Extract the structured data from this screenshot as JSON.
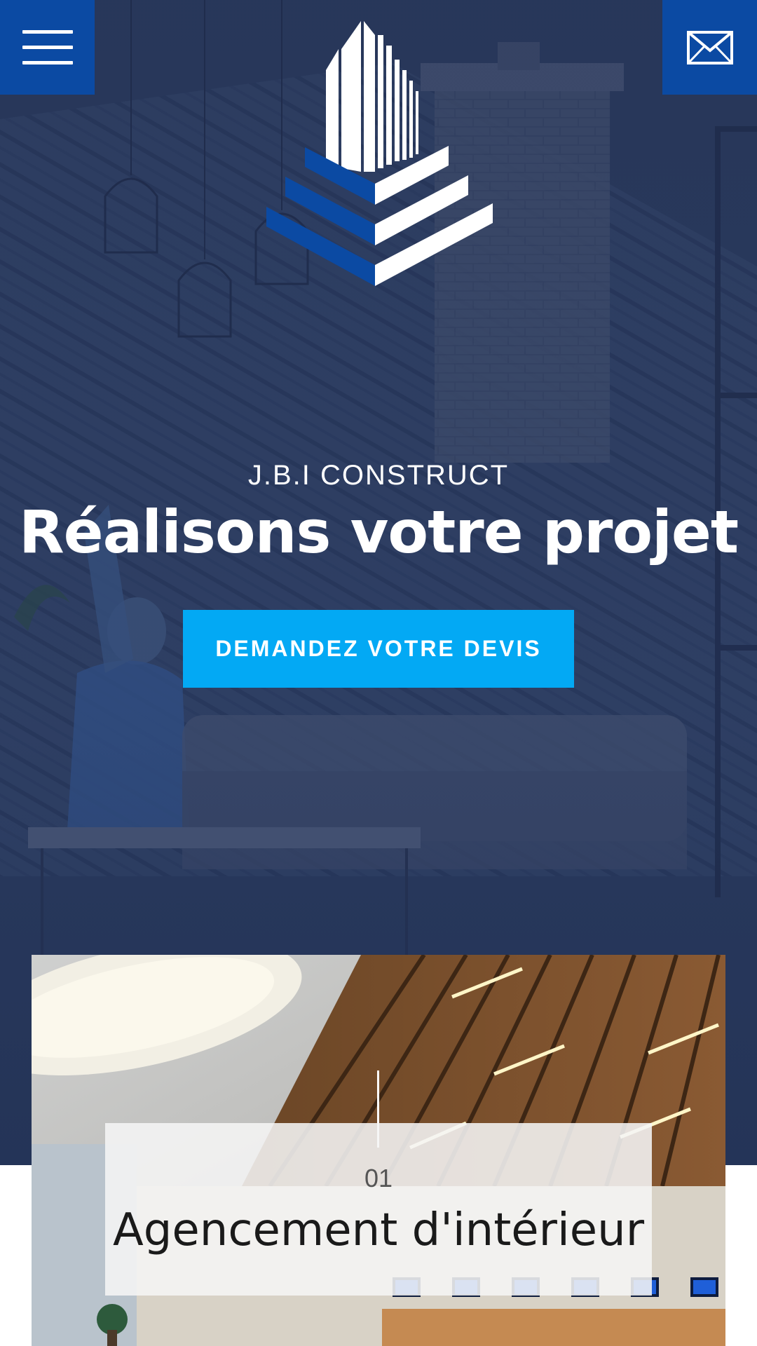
{
  "header": {
    "menu_icon": "hamburger-menu-icon",
    "mail_icon": "envelope-icon",
    "logo_icon": "jbi-building-logo",
    "brand_color": "#0b4aa3"
  },
  "hero": {
    "eyebrow": "J.B.I CONSTRUCT",
    "title": "Réalisons votre projet",
    "cta_label": "DEMANDEZ VOTRE DEVIS",
    "cta_color": "#03a9f4"
  },
  "services": [
    {
      "number": "01",
      "title": "Agencement d'intérieur"
    }
  ]
}
